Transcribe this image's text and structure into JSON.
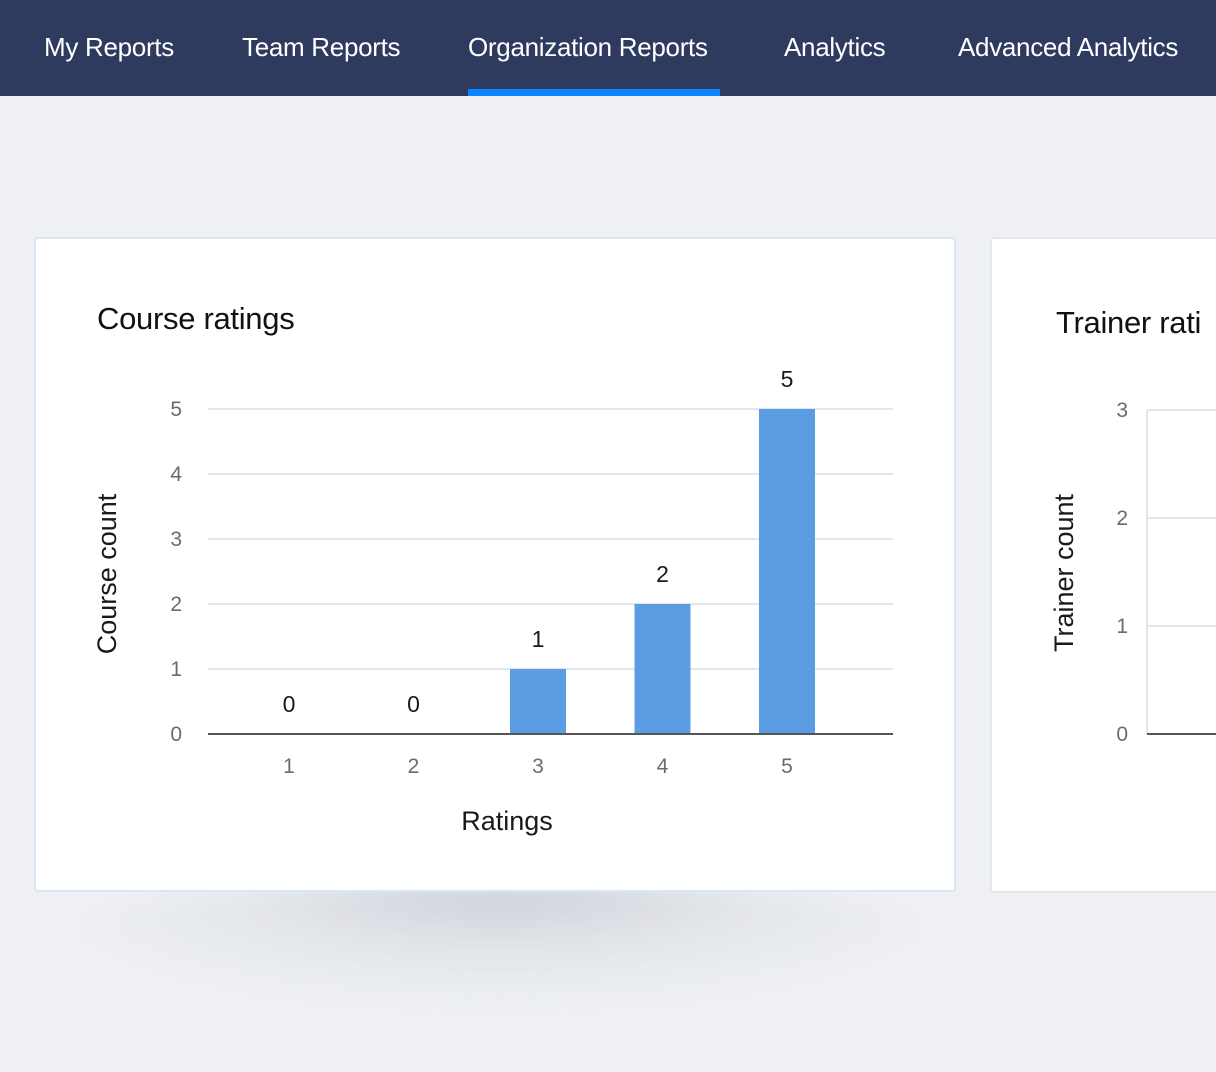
{
  "nav": {
    "items": [
      {
        "label": "My Reports",
        "active": false
      },
      {
        "label": "Team Reports",
        "active": false
      },
      {
        "label": "Organization Reports",
        "active": true
      },
      {
        "label": "Analytics",
        "active": false
      },
      {
        "label": "Advanced Analytics",
        "active": false
      }
    ],
    "accent_color": "#0a84ff",
    "background_color": "#2e3b5f"
  },
  "cards": {
    "course": {
      "title": "Course ratings"
    },
    "trainer": {
      "title": "Trainer rati"
    }
  },
  "chart_data": [
    {
      "type": "bar",
      "title": "Course ratings",
      "xlabel": "Ratings",
      "ylabel": "Course count",
      "categories": [
        "1",
        "2",
        "3",
        "4",
        "5"
      ],
      "values": [
        0,
        0,
        1,
        2,
        5
      ],
      "data_labels": [
        "0",
        "0",
        "1",
        "2",
        "5"
      ],
      "yticks": [
        "0",
        "1",
        "2",
        "3",
        "4",
        "5"
      ],
      "ylim": [
        0,
        5
      ],
      "grid": true,
      "bar_color": "#5a9de3"
    },
    {
      "type": "bar",
      "title": "Trainer rati",
      "ylabel": "Trainer count",
      "yticks": [
        "0",
        "1",
        "2",
        "3"
      ],
      "ylim": [
        0,
        3
      ],
      "grid": true,
      "categories": [],
      "values": []
    }
  ]
}
